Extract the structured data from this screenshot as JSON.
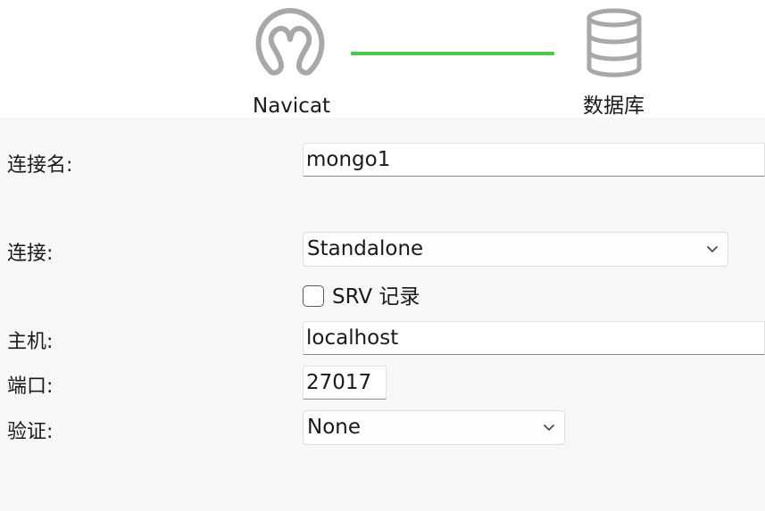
{
  "header": {
    "source_label": "Navicat",
    "source_icon": "navicat-icon",
    "target_label": "数据库",
    "target_icon": "database-icon",
    "connector_color": "#4cc94c"
  },
  "form": {
    "connection_name": {
      "label": "连接名:",
      "value": "mongo1"
    },
    "connection_type": {
      "label": "连接:",
      "selected": "Standalone"
    },
    "srv_record": {
      "label": "SRV 记录",
      "checked": false
    },
    "host": {
      "label": "主机:",
      "value": "localhost"
    },
    "port": {
      "label": "端口:",
      "value": "27017"
    },
    "auth": {
      "label": "验证:",
      "selected": "None"
    }
  }
}
